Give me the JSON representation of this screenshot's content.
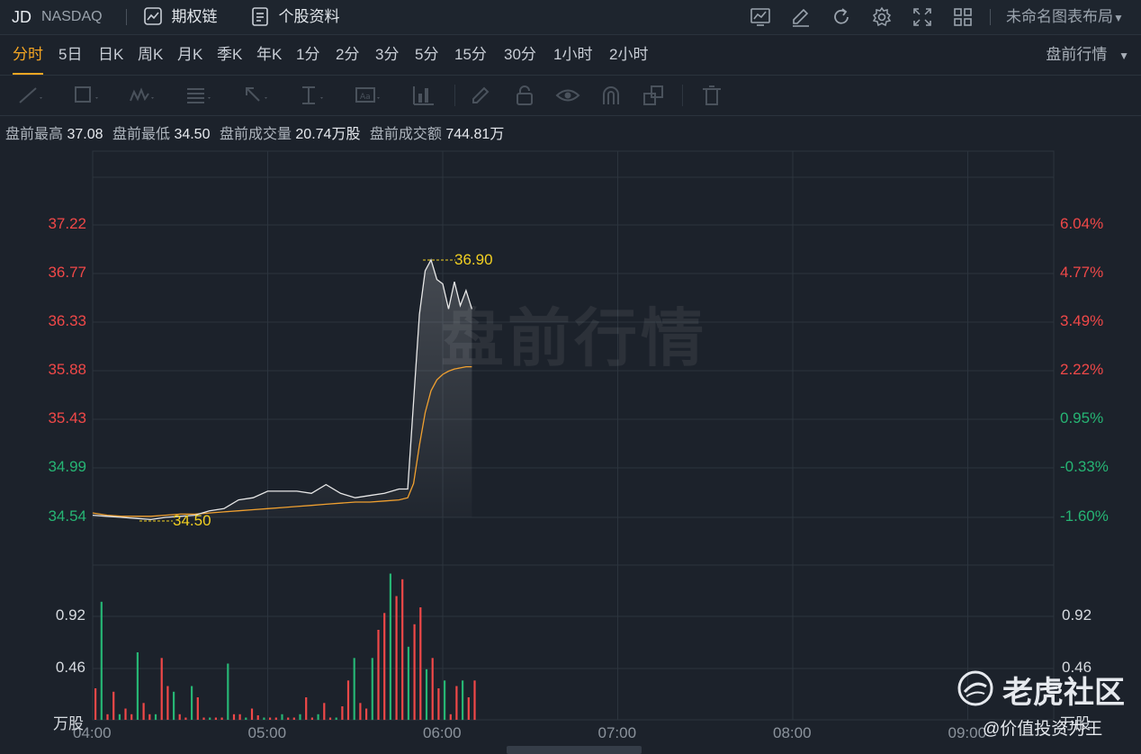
{
  "header": {
    "ticker": "JD",
    "exchange": "NASDAQ",
    "options_chain": "期权链",
    "stock_profile": "个股资料",
    "layout_name": "未命名图表布局",
    "icons": [
      "chart-icon",
      "draw-icon",
      "refresh-icon",
      "settings-icon",
      "fullscreen-icon",
      "grid-icon"
    ]
  },
  "periods": [
    "分时",
    "5日",
    "日K",
    "周K",
    "月K",
    "季K",
    "年K",
    "1分",
    "2分",
    "3分",
    "5分",
    "15分",
    "30分",
    "1小时",
    "2小时"
  ],
  "active_period": "分时",
  "session_select": "盘前行情",
  "drawing_tools": [
    "line-tool-icon",
    "rect-tool-icon",
    "wave-tool-icon",
    "fib-tool-icon",
    "arrow-tool-icon",
    "measure-tool-icon",
    "text-tool-icon",
    "bars-tool-icon",
    "pen-icon",
    "lock-icon",
    "eye-icon",
    "magnet-icon",
    "layers-icon",
    "trash-icon"
  ],
  "info": {
    "high_label": "盘前最高",
    "high": "37.08",
    "low_label": "盘前最低",
    "low": "34.50",
    "volume_label": "盘前成交量",
    "volume": "20.74万股",
    "turnover_label": "盘前成交额",
    "turnover": "744.81万"
  },
  "watermark": "盘前行情",
  "price_axis": [
    "37.22",
    "36.77",
    "36.33",
    "35.88",
    "35.43",
    "34.99",
    "34.54"
  ],
  "pct_axis": [
    "6.04%",
    "4.77%",
    "3.49%",
    "2.22%",
    "0.95%",
    "-0.33%",
    "-1.60%"
  ],
  "volume_axis": [
    "0.92",
    "0.46"
  ],
  "volume_unit": "万股",
  "time_axis": [
    "04:00",
    "05:00",
    "06:00",
    "07:00",
    "08:00",
    "09:00"
  ],
  "annotations": {
    "high_mark": "36.90",
    "low_mark": "34.50"
  },
  "brand": {
    "name": "老虎社区",
    "sub": "@价值投资为王"
  },
  "colors": {
    "up": "#f04848",
    "down": "#26b574",
    "price_line": "#e8e8e8",
    "avg_line": "#f0a030",
    "active_tab": "#f5a623",
    "mark": "#f2d022"
  },
  "chart_data": {
    "type": "line",
    "ylim": [
      34.54,
      37.22
    ],
    "x": [
      "04:00",
      "04:05",
      "04:10",
      "04:15",
      "04:20",
      "04:25",
      "04:30",
      "04:35",
      "04:40",
      "04:45",
      "04:50",
      "04:55",
      "05:00",
      "05:05",
      "05:10",
      "05:15",
      "05:20",
      "05:25",
      "05:30",
      "05:35",
      "05:40",
      "05:45",
      "05:48",
      "05:50",
      "05:52",
      "05:54",
      "05:56",
      "05:58",
      "06:00",
      "06:02",
      "06:04",
      "06:06",
      "06:08",
      "06:10"
    ],
    "series": [
      {
        "values": [
          34.56,
          34.55,
          34.54,
          34.53,
          34.52,
          34.54,
          34.55,
          34.56,
          34.6,
          34.62,
          34.7,
          34.72,
          34.78,
          34.78,
          34.78,
          34.76,
          34.84,
          34.76,
          34.72,
          34.74,
          34.76,
          34.8,
          34.8,
          35.6,
          36.4,
          36.8,
          36.9,
          36.72,
          36.68,
          36.45,
          36.7,
          36.48,
          36.62,
          36.45
        ]
      },
      {
        "values": [
          34.58,
          34.56,
          34.55,
          34.55,
          34.55,
          34.56,
          34.57,
          34.57,
          34.58,
          34.59,
          34.6,
          34.61,
          34.62,
          34.63,
          34.64,
          34.65,
          34.66,
          34.67,
          34.68,
          34.68,
          34.69,
          34.7,
          34.72,
          34.85,
          35.2,
          35.5,
          35.7,
          35.8,
          35.85,
          35.88,
          35.9,
          35.91,
          35.92,
          35.92
        ]
      }
    ],
    "volume": [
      0.28,
      1.05,
      0.05,
      0.25,
      0.05,
      0.1,
      0.05,
      0.6,
      0.15,
      0.05,
      0.05,
      0.55,
      0.3,
      0.25,
      0.05,
      0.02,
      0.3,
      0.2,
      0.02,
      0.02,
      0.02,
      0.02,
      0.5,
      0.05,
      0.05,
      0.02,
      0.1,
      0.04,
      0.02,
      0.02,
      0.02,
      0.05,
      0.02,
      0.02,
      0.05,
      0.2,
      0.02,
      0.05,
      0.15,
      0.02,
      0.02,
      0.12,
      0.35,
      0.55,
      0.15,
      0.1,
      0.55,
      0.8,
      0.95,
      1.3,
      1.1,
      1.25,
      0.65,
      0.85,
      1.0,
      0.45,
      0.55,
      0.28,
      0.35,
      0.05,
      0.3,
      0.35,
      0.2,
      0.35
    ]
  }
}
